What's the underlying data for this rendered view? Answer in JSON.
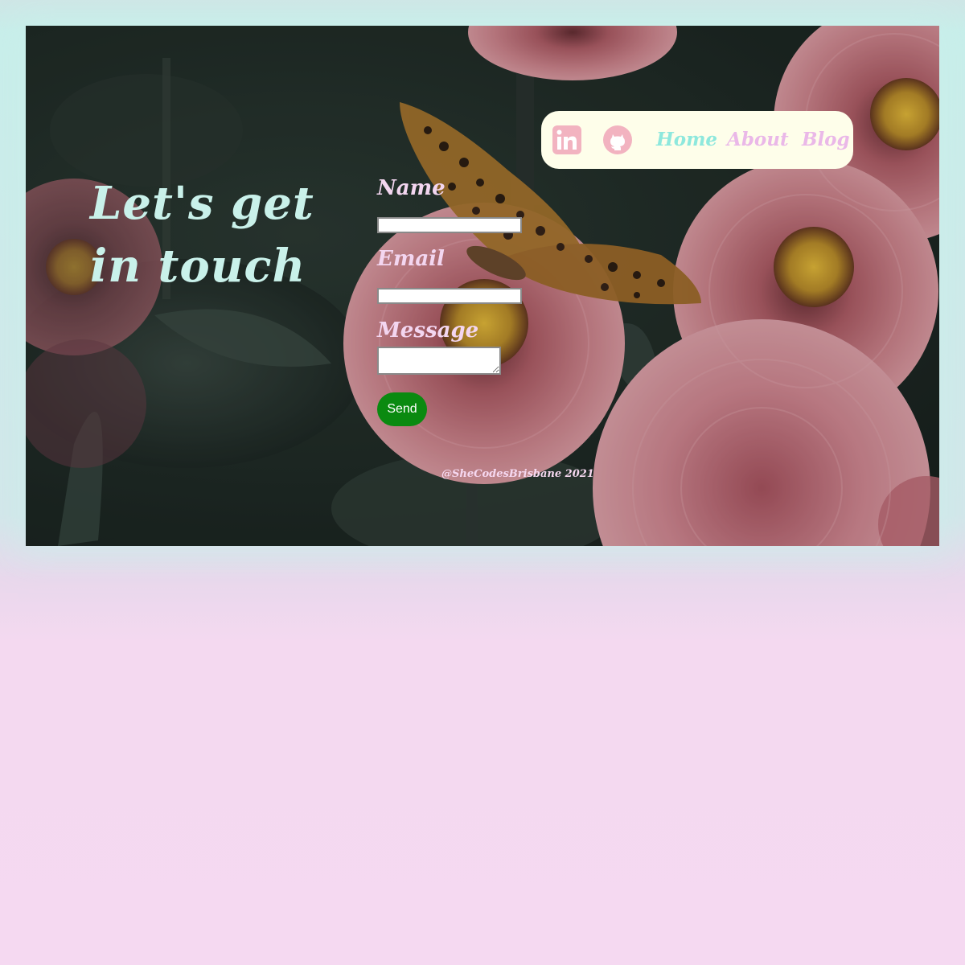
{
  "hero": {
    "headline": "Let's get in touch"
  },
  "nav": {
    "icons": [
      "linkedin-icon",
      "github-icon"
    ],
    "links": [
      "Home",
      "About",
      "Blog"
    ]
  },
  "form": {
    "name_label": "Name",
    "email_label": "Email",
    "message_label": "Message",
    "name_value": "",
    "email_value": "",
    "message_value": "",
    "send_label": "Send"
  },
  "footer": {
    "credit": "@SheCodesBrisbane 2021"
  },
  "colors": {
    "headline": "#c9f1ea",
    "nav_bg": "#fefeea",
    "nav_home": "#8ee8dd",
    "nav_about": "#eab8e8",
    "nav_blog": "#eab8e8",
    "icon_pink": "#f2b3c0",
    "form_label": "#f3d6f0",
    "send_bg": "#0a8a10",
    "page_bg": "#f5d9f1"
  }
}
